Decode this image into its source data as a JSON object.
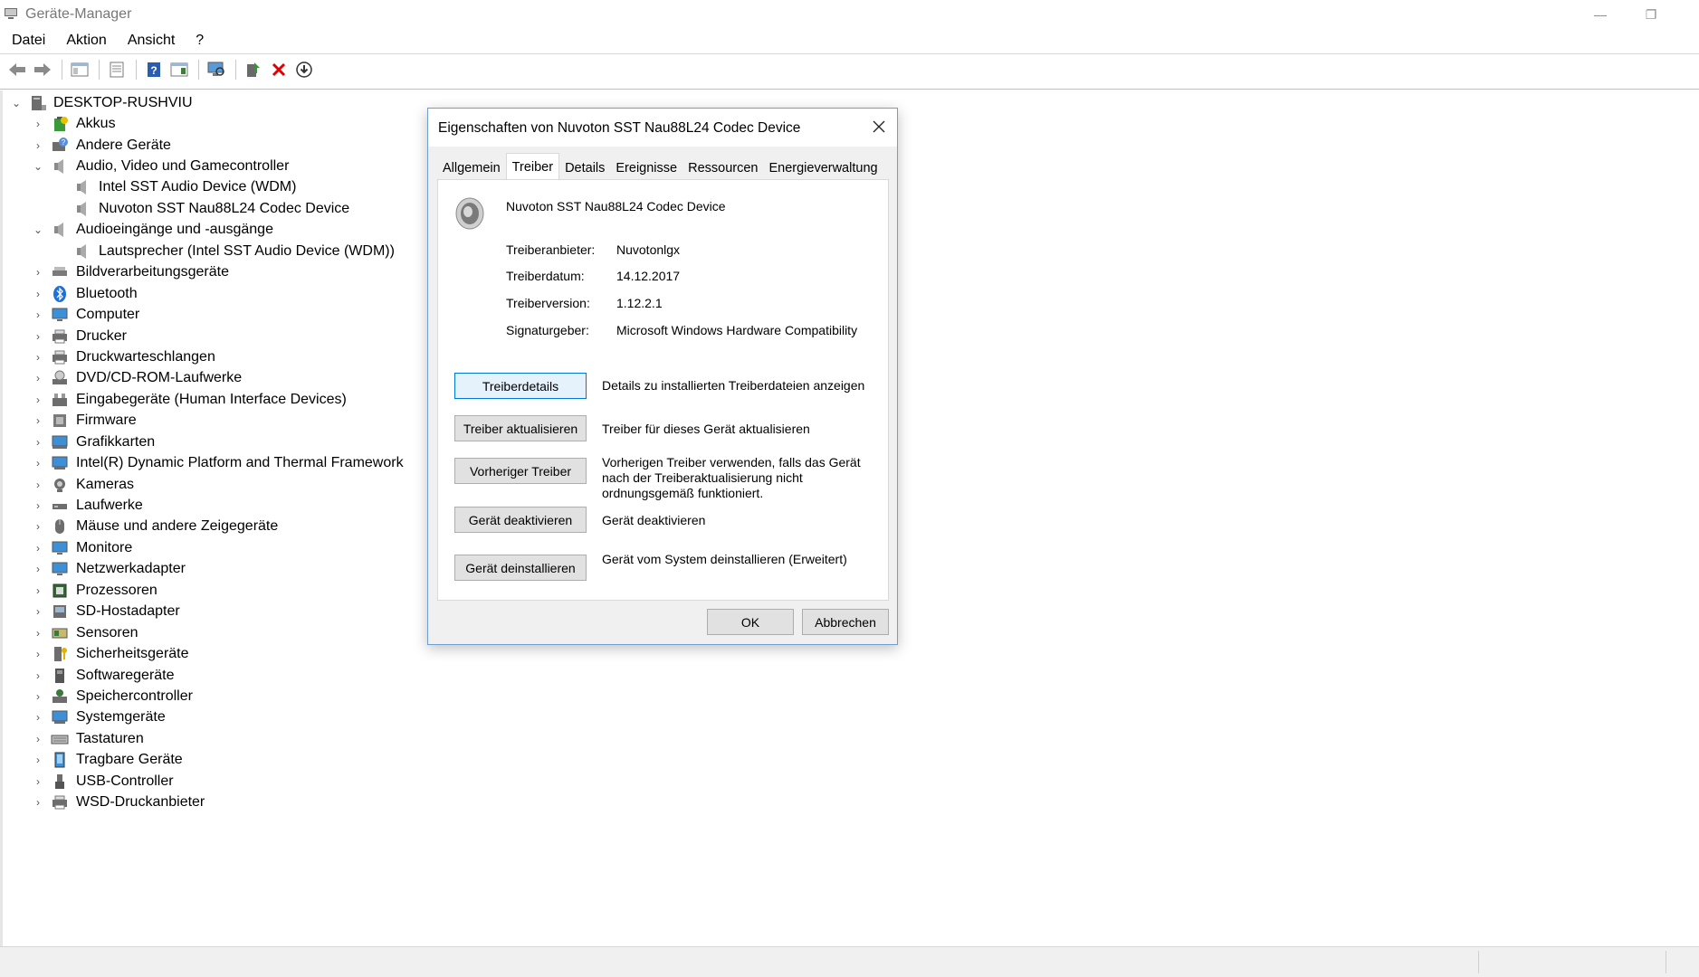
{
  "window": {
    "title": "Geräte-Manager",
    "minimize_glyph": "—",
    "restore_glyph": "❐"
  },
  "menu": [
    "Datei",
    "Aktion",
    "Ansicht",
    "?"
  ],
  "toolbar": {
    "icons": [
      "back-arrow-icon",
      "forward-arrow-icon",
      "show-hide-console-tree-icon",
      "properties-icon",
      "help-icon",
      "action-pane-icon",
      "scan-hardware-icon",
      "update-driver-icon",
      "uninstall-device-icon",
      "disable-device-icon"
    ]
  },
  "tree": {
    "root": "DESKTOP-RUSHVIU",
    "categories": [
      {
        "label": "Akkus",
        "icon": "battery-icon",
        "expanded": false
      },
      {
        "label": "Andere Geräte",
        "icon": "unknown-device-icon",
        "expanded": false
      },
      {
        "label": "Audio, Video und Gamecontroller",
        "icon": "speaker-icon",
        "expanded": true,
        "children": [
          "Intel SST Audio Device (WDM)",
          "Nuvoton SST Nau88L24 Codec Device"
        ]
      },
      {
        "label": "Audioeingänge und -ausgänge",
        "icon": "speaker-icon",
        "expanded": true,
        "children": [
          "Lautsprecher (Intel SST Audio Device (WDM))"
        ]
      },
      {
        "label": "Bildverarbeitungsgeräte",
        "icon": "scanner-icon",
        "expanded": false
      },
      {
        "label": "Bluetooth",
        "icon": "bluetooth-icon",
        "expanded": false
      },
      {
        "label": "Computer",
        "icon": "monitor-icon",
        "expanded": false
      },
      {
        "label": "Drucker",
        "icon": "printer-icon",
        "expanded": false
      },
      {
        "label": "Druckwarteschlangen",
        "icon": "printer-icon",
        "expanded": false
      },
      {
        "label": "DVD/CD-ROM-Laufwerke",
        "icon": "disc-drive-icon",
        "expanded": false
      },
      {
        "label": "Eingabegeräte (Human Interface Devices)",
        "icon": "hid-icon",
        "expanded": false
      },
      {
        "label": "Firmware",
        "icon": "firmware-icon",
        "expanded": false
      },
      {
        "label": "Grafikkarten",
        "icon": "display-adapter-icon",
        "expanded": false
      },
      {
        "label": "Intel(R) Dynamic Platform and Thermal Framework",
        "icon": "system-device-icon",
        "expanded": false
      },
      {
        "label": "Kameras",
        "icon": "camera-icon",
        "expanded": false
      },
      {
        "label": "Laufwerke",
        "icon": "disk-drive-icon",
        "expanded": false
      },
      {
        "label": "Mäuse und andere Zeigegeräte",
        "icon": "mouse-icon",
        "expanded": false
      },
      {
        "label": "Monitore",
        "icon": "monitor-icon",
        "expanded": false
      },
      {
        "label": "Netzwerkadapter",
        "icon": "network-adapter-icon",
        "expanded": false
      },
      {
        "label": "Prozessoren",
        "icon": "processor-icon",
        "expanded": false
      },
      {
        "label": "SD-Hostadapter",
        "icon": "sd-card-icon",
        "expanded": false
      },
      {
        "label": "Sensoren",
        "icon": "sensor-icon",
        "expanded": false
      },
      {
        "label": "Sicherheitsgeräte",
        "icon": "security-device-icon",
        "expanded": false
      },
      {
        "label": "Softwaregeräte",
        "icon": "software-device-icon",
        "expanded": false
      },
      {
        "label": "Speichercontroller",
        "icon": "storage-controller-icon",
        "expanded": false
      },
      {
        "label": "Systemgeräte",
        "icon": "system-device-icon",
        "expanded": false
      },
      {
        "label": "Tastaturen",
        "icon": "keyboard-icon",
        "expanded": false
      },
      {
        "label": "Tragbare Geräte",
        "icon": "portable-device-icon",
        "expanded": false
      },
      {
        "label": "USB-Controller",
        "icon": "usb-icon",
        "expanded": false
      },
      {
        "label": "WSD-Druckanbieter",
        "icon": "printer-icon",
        "expanded": false
      }
    ]
  },
  "dialog": {
    "title": "Eigenschaften von Nuvoton SST Nau88L24 Codec Device",
    "tabs": [
      "Allgemein",
      "Treiber",
      "Details",
      "Ereignisse",
      "Ressourcen",
      "Energieverwaltung"
    ],
    "active_tab": "Treiber",
    "device_name": "Nuvoton SST Nau88L24 Codec Device",
    "properties": [
      {
        "label": "Treiberanbieter:",
        "value": "Nuvotonlgx"
      },
      {
        "label": "Treiberdatum:",
        "value": "14.12.2017"
      },
      {
        "label": "Treiberversion:",
        "value": "1.12.2.1"
      },
      {
        "label": "Signaturgeber:",
        "value": "Microsoft Windows Hardware Compatibility"
      }
    ],
    "actions": [
      {
        "button": "Treiberdetails",
        "description": "Details zu installierten Treiberdateien anzeigen"
      },
      {
        "button": "Treiber aktualisieren",
        "description": "Treiber für dieses Gerät aktualisieren"
      },
      {
        "button": "Vorheriger Treiber",
        "description": "Vorherigen Treiber verwenden, falls das Gerät nach der Treiberaktualisierung nicht ordnungsgemäß funktioniert."
      },
      {
        "button": "Gerät deaktivieren",
        "description": "Gerät deaktivieren"
      },
      {
        "button": "Gerät deinstallieren",
        "description": "Gerät vom System deinstallieren (Erweitert)"
      }
    ],
    "ok": "OK",
    "cancel": "Abbrechen"
  },
  "colors": {
    "accent": "#0078d7",
    "dialog_border": "#6e9fd0",
    "uninstall_red": "#e00000"
  }
}
